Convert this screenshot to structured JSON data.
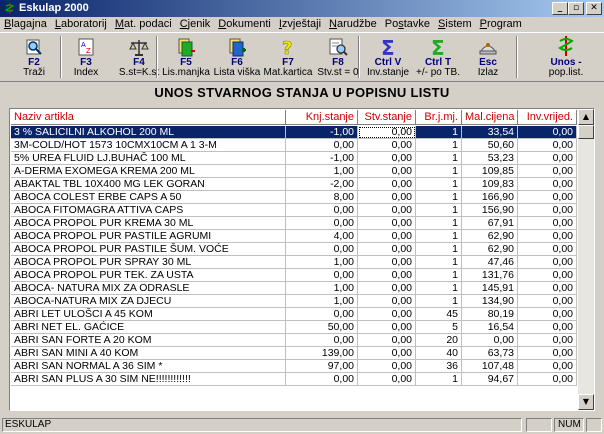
{
  "window": {
    "title": "Eskulap 2000"
  },
  "menu": [
    "Blagajna",
    "Laboratorij",
    "Mat. podaci",
    "Cjenik",
    "Dokumenti",
    "Izvještaji",
    "Narudžbe",
    "Postavke",
    "Sistem",
    "Program"
  ],
  "toolbar": [
    {
      "key": "F2",
      "label": "Traži",
      "icon": "search-icon"
    },
    {
      "key": "F3",
      "label": "Index",
      "icon": "index-icon"
    },
    {
      "key": "F4",
      "label": "S.st=K.st",
      "icon": "scale-icon"
    },
    {
      "key": "F5",
      "label": "Lis.manjka",
      "icon": "list-minus-icon"
    },
    {
      "key": "F6",
      "label": "Lista viška",
      "icon": "list-plus-icon"
    },
    {
      "key": "F7",
      "label": "Mat.kartica",
      "icon": "question-icon"
    },
    {
      "key": "F8",
      "label": "Stv.st = 0",
      "icon": "magnifier-doc-icon"
    },
    {
      "key": "Ctrl V",
      "label": "Inv.stanje",
      "icon": "sigma-icon"
    },
    {
      "key": "Ctrl T",
      "label": "+/- po TB.",
      "icon": "sigma-green-icon"
    },
    {
      "key": "Esc",
      "label": "Izlaz",
      "icon": "exit-icon"
    },
    {
      "key": "Unos -",
      "label": "pop.list.",
      "icon": "caduceus-icon"
    }
  ],
  "page_title": "UNOS STVARNOG STANJA U POPISNU LISTU",
  "columns": [
    "Naziv artikla",
    "Knj.stanje",
    "Stv.stanje",
    "Br.j.mj.",
    "Mal.cijena",
    "Inv.vrijed."
  ],
  "rows": [
    [
      "3 % SALICILNI ALKOHOL 200 ML",
      "-1,00",
      "0,00",
      "1",
      "33,54",
      "0,00"
    ],
    [
      "3M-COLD/HOT 1573 10CMX10CM A 1 3-M",
      "0,00",
      "0,00",
      "1",
      "50,60",
      "0,00"
    ],
    [
      "5% UREA FLUID LJ.BUHAČ 100 ML",
      "-1,00",
      "0,00",
      "1",
      "53,23",
      "0,00"
    ],
    [
      "A-DERMA EXOMEGA KREMA 200 ML",
      "1,00",
      "0,00",
      "1",
      "109,85",
      "0,00"
    ],
    [
      "ABAKTAL TBL 10X400 MG LEK GORAN",
      "-2,00",
      "0,00",
      "1",
      "109,83",
      "0,00"
    ],
    [
      "ABOCA COLEST ERBE CAPS A 50",
      "8,00",
      "0,00",
      "1",
      "166,90",
      "0,00"
    ],
    [
      "ABOCA FITOMAGRA ATTIVA CAPS",
      "0,00",
      "0,00",
      "1",
      "156,90",
      "0,00"
    ],
    [
      "ABOCA PROPOL PUR KREMA 30 ML",
      "0,00",
      "0,00",
      "1",
      "67,91",
      "0,00"
    ],
    [
      "ABOCA PROPOL PUR PASTILE AGRUMI",
      "4,00",
      "0,00",
      "1",
      "62,90",
      "0,00"
    ],
    [
      "ABOCA PROPOL PUR PASTILE ŠUM. VOĆE",
      "0,00",
      "0,00",
      "1",
      "62,90",
      "0,00"
    ],
    [
      "ABOCA PROPOL PUR SPRAY 30 ML",
      "1,00",
      "0,00",
      "1",
      "47,46",
      "0,00"
    ],
    [
      "ABOCA PROPOL PUR TEK. ZA USTA",
      "0,00",
      "0,00",
      "1",
      "131,76",
      "0,00"
    ],
    [
      "ABOCA- NATURA MIX ZA ODRASLE",
      "1,00",
      "0,00",
      "1",
      "145,91",
      "0,00"
    ],
    [
      "ABOCA-NATURA MIX ZA DJECU",
      "1,00",
      "0,00",
      "1",
      "134,90",
      "0,00"
    ],
    [
      "ABRI LET ULOŠCI A 45 KOM",
      "0,00",
      "0,00",
      "45",
      "80,19",
      "0,00"
    ],
    [
      "ABRI NET EL. GAĆICE",
      "50,00",
      "0,00",
      "5",
      "16,54",
      "0,00"
    ],
    [
      "ABRI SAN FORTE A 20 KOM",
      "0,00",
      "0,00",
      "20",
      "0,00",
      "0,00"
    ],
    [
      "ABRI SAN MINI A 40 KOM",
      "139,00",
      "0,00",
      "40",
      "63,73",
      "0,00"
    ],
    [
      "ABRI SAN NORMAL A 36 SIM *",
      "97,00",
      "0,00",
      "36",
      "107,48",
      "0,00"
    ],
    [
      "ABRI SAN PLUS A 30 SIM NE!!!!!!!!!!!!",
      "0,00",
      "0,00",
      "1",
      "94,67",
      "0,00"
    ]
  ],
  "status": {
    "left": "ESKULAP",
    "num": "NUM"
  }
}
